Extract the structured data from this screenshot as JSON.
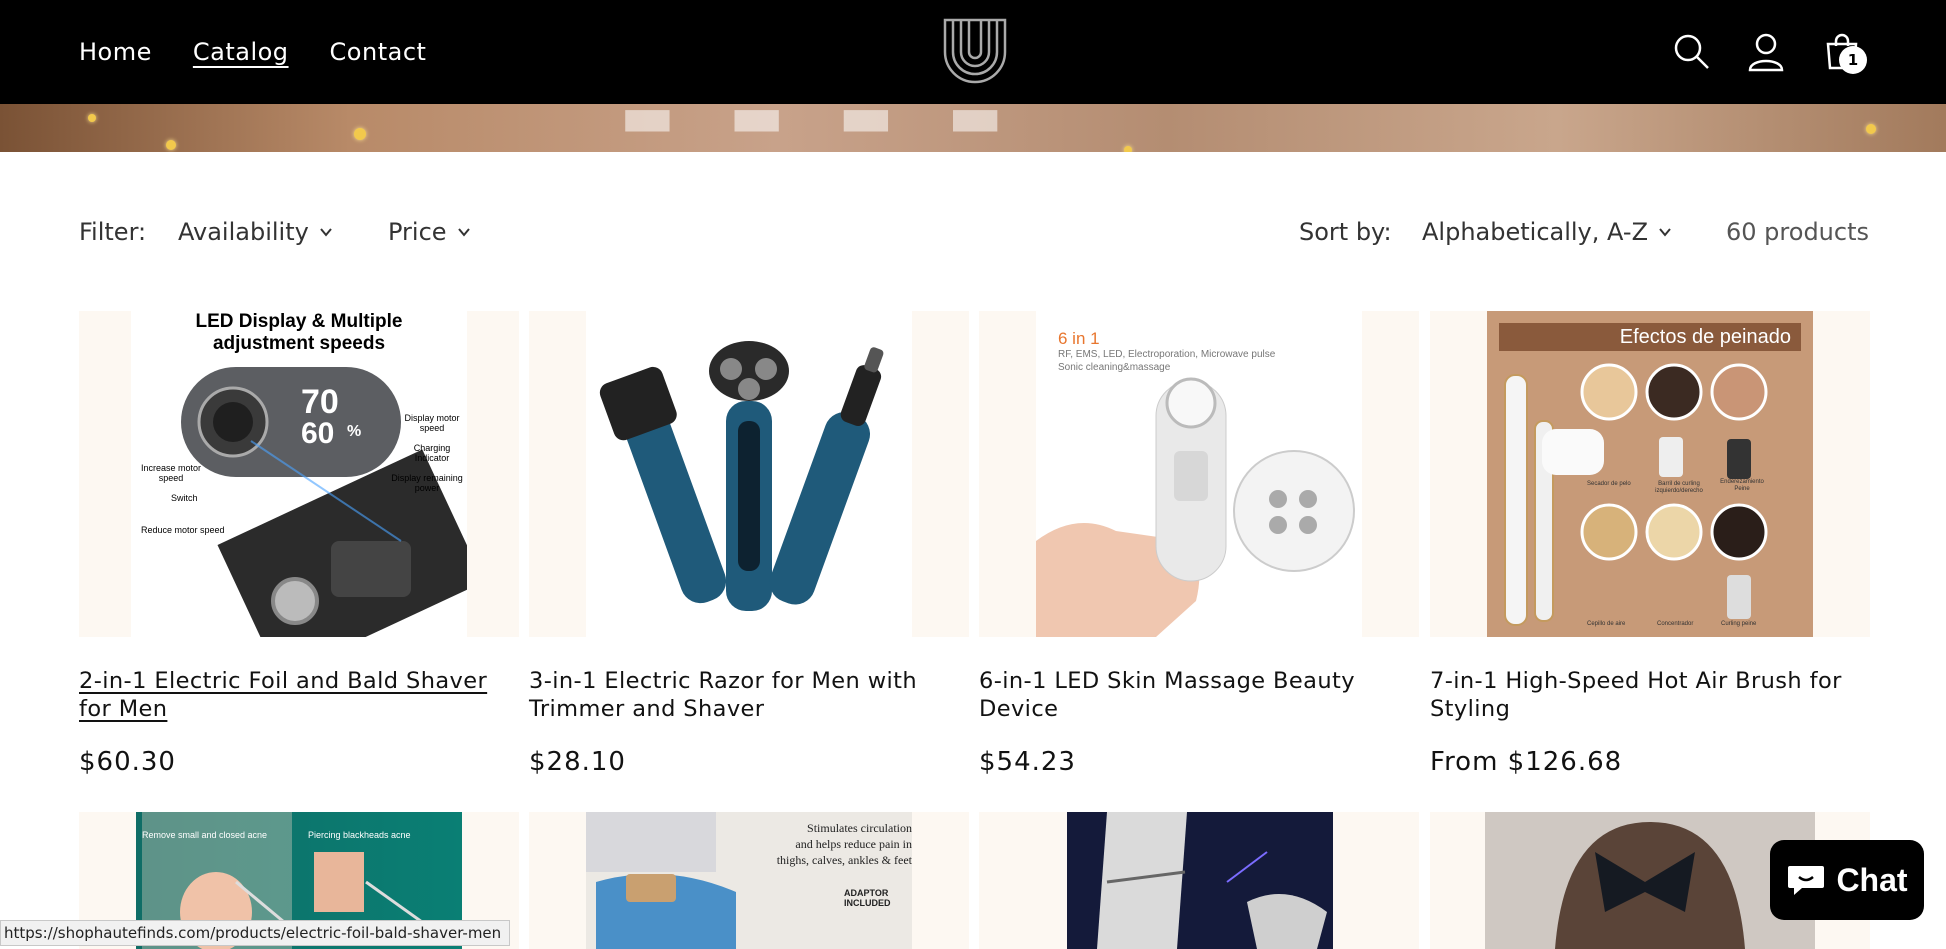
{
  "nav": {
    "items": [
      {
        "label": "Home"
      },
      {
        "label": "Catalog"
      },
      {
        "label": "Contact"
      }
    ]
  },
  "header": {
    "cart_count": "1"
  },
  "filter": {
    "label": "Filter:",
    "availability": "Availability",
    "price": "Price",
    "sort_label": "Sort by:",
    "sort_value": "Alphabetically, A-Z",
    "count": "60 products"
  },
  "products": [
    {
      "title": "2-in-1 Electric Foil and Bald Shaver for Men",
      "price": "$60.30",
      "image_text": {
        "heading": "LED Display & Multiple adjustment speeds",
        "callouts": [
          "Display motor speed",
          "Charging Indicator",
          "Display remaining power",
          "Increase motor speed",
          "Switch",
          "Reduce motor speed"
        ],
        "display": "70",
        "display2": "60",
        "percent": "%"
      }
    },
    {
      "title": "3-in-1 Electric Razor for Men with Trimmer and Shaver",
      "price": "$28.10"
    },
    {
      "title": "6-in-1 LED Skin Massage Beauty Device",
      "price": "$54.23",
      "image_text": {
        "heading": "6 in 1",
        "sub1": "RF, EMS, LED, Electroporation, Microwave pulse",
        "sub2": "Sonic cleaning&massage"
      }
    },
    {
      "title": "7-in-1 High-Speed Hot Air Brush for Styling",
      "price": "From $126.68",
      "image_text": {
        "heading": "Efectos de peinado",
        "labels": [
          "Secador de pelo",
          "Barril de curling izquierdo/derecho",
          "Enderezamiento Peine",
          "Cepillo de aire",
          "Concentrador",
          "Curling peine"
        ]
      }
    }
  ],
  "row2": [
    {
      "image_text": [
        "Remove small and closed acne",
        "Piercing blackheads acne"
      ]
    },
    {
      "image_text": [
        "Stimulates circulation",
        "and helps reduce pain in",
        "thighs, calves, ankles & feet",
        "ADAPTOR INCLUDED"
      ]
    },
    {},
    {}
  ],
  "status_url": "https://shophautefinds.com/products/electric-foil-bald-shaver-men",
  "chat_label": "Chat"
}
